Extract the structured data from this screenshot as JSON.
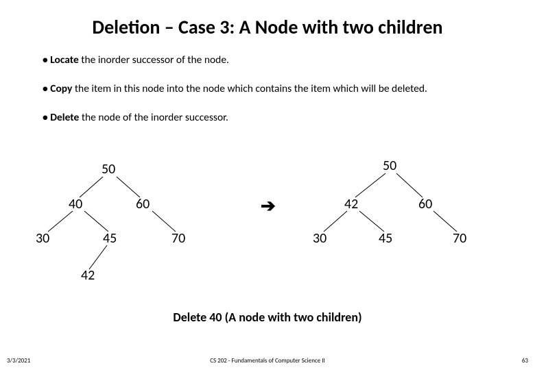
{
  "title": "Deletion – Case 3: A Node with two children",
  "bullets": {
    "b1_strong": "Locate",
    "b1_rest": " the inorder successor of the node.",
    "b2_strong": "Copy",
    "b2_rest": " the item in this node into the node which contains the item which will be deleted.",
    "b3_strong": "Delete",
    "b3_rest": " the node of the inorder successor."
  },
  "arrow": "➔",
  "leftTree": {
    "n50": "50",
    "n40": "40",
    "n60": "60",
    "n30": "30",
    "n45": "45",
    "n70": "70",
    "n42": "42"
  },
  "rightTree": {
    "n50": "50",
    "n42": "42",
    "n60": "60",
    "n30": "30",
    "n45": "45",
    "n70": "70"
  },
  "caption": "Delete 40 (A  node with two children)",
  "footer": {
    "date": "3/3/2021",
    "center": "CS 202 - Fundamentals of Computer Science II",
    "num": "63"
  }
}
